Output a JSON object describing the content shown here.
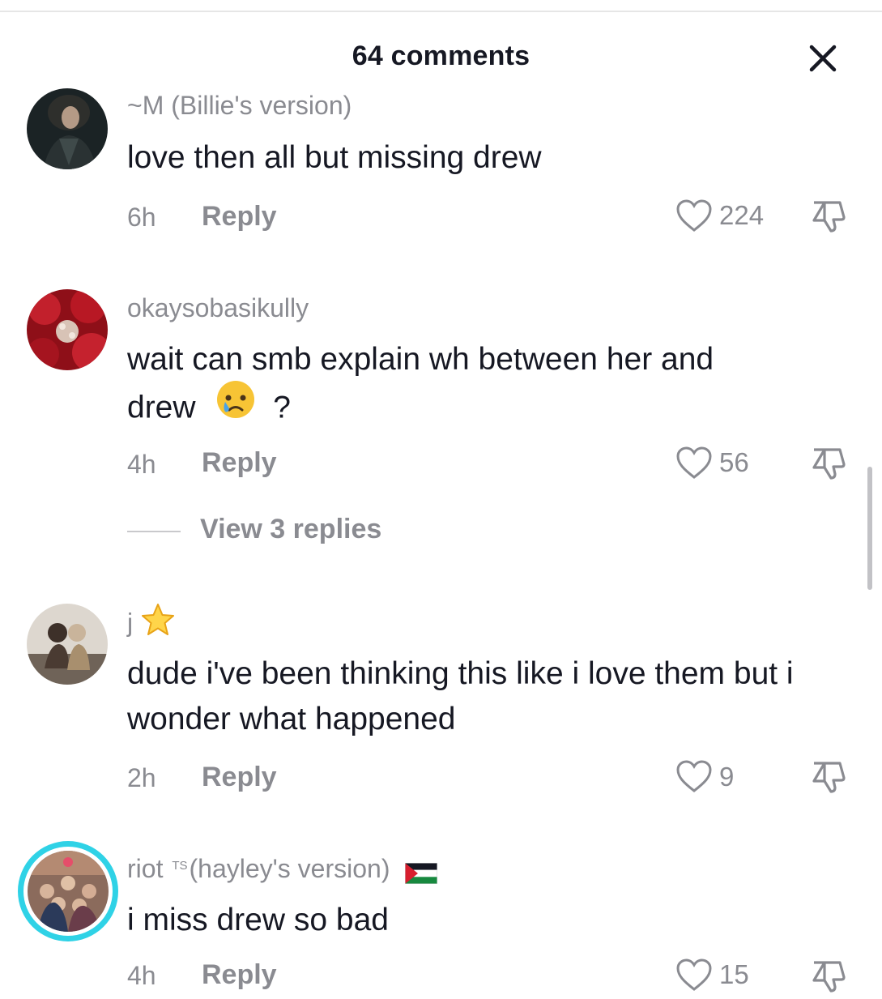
{
  "header": {
    "title": "64 comments"
  },
  "icons": {
    "close": "close-icon",
    "like": "heart-outline-icon",
    "dislike": "thumbs-down-icon"
  },
  "colors": {
    "muted": "#8a8b91",
    "text": "#161823",
    "ring": "#2fd2e6"
  },
  "comments": [
    {
      "username": "~M (Billie's version)",
      "text": "love then all but missing drew",
      "time": "6h",
      "reply": "Reply",
      "likes": "224"
    },
    {
      "username": "okaysobasikully",
      "text_line1": "wait can smb explain wh between her and",
      "text_line2_a": "drew",
      "text_line2_b": "?",
      "emoji": "sad-but-relieved-face",
      "time": "4h",
      "reply": "Reply",
      "likes": "56",
      "view_replies": "View 3 replies"
    },
    {
      "username": "j",
      "username_emoji": "star",
      "text": "dude i've been thinking this like i love them but i wonder what happened",
      "time": "2h",
      "reply": "Reply",
      "likes": "9"
    },
    {
      "username_a": "riot",
      "username_sup": "TS",
      "username_b": "(hayley's version)",
      "username_emoji": "flag-palestine",
      "text": "i miss drew so bad",
      "time": "4h",
      "reply": "Reply",
      "likes": "15"
    }
  ]
}
